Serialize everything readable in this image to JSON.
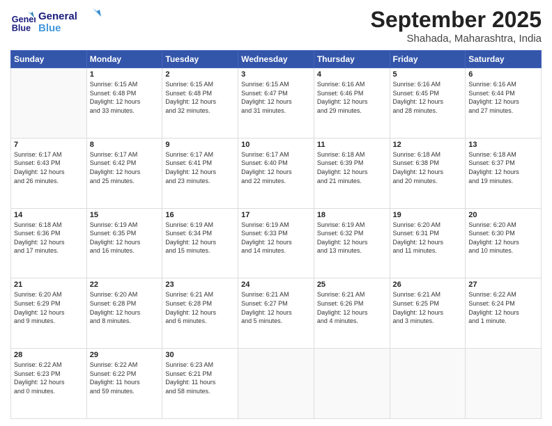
{
  "header": {
    "logo": {
      "line1": "General",
      "line2": "Blue"
    },
    "title": "September 2025",
    "subtitle": "Shahada, Maharashtra, India"
  },
  "weekdays": [
    "Sunday",
    "Monday",
    "Tuesday",
    "Wednesday",
    "Thursday",
    "Friday",
    "Saturday"
  ],
  "weeks": [
    [
      {
        "day": "",
        "info": ""
      },
      {
        "day": "1",
        "info": "Sunrise: 6:15 AM\nSunset: 6:48 PM\nDaylight: 12 hours\nand 33 minutes."
      },
      {
        "day": "2",
        "info": "Sunrise: 6:15 AM\nSunset: 6:48 PM\nDaylight: 12 hours\nand 32 minutes."
      },
      {
        "day": "3",
        "info": "Sunrise: 6:15 AM\nSunset: 6:47 PM\nDaylight: 12 hours\nand 31 minutes."
      },
      {
        "day": "4",
        "info": "Sunrise: 6:16 AM\nSunset: 6:46 PM\nDaylight: 12 hours\nand 29 minutes."
      },
      {
        "day": "5",
        "info": "Sunrise: 6:16 AM\nSunset: 6:45 PM\nDaylight: 12 hours\nand 28 minutes."
      },
      {
        "day": "6",
        "info": "Sunrise: 6:16 AM\nSunset: 6:44 PM\nDaylight: 12 hours\nand 27 minutes."
      }
    ],
    [
      {
        "day": "7",
        "info": "Sunrise: 6:17 AM\nSunset: 6:43 PM\nDaylight: 12 hours\nand 26 minutes."
      },
      {
        "day": "8",
        "info": "Sunrise: 6:17 AM\nSunset: 6:42 PM\nDaylight: 12 hours\nand 25 minutes."
      },
      {
        "day": "9",
        "info": "Sunrise: 6:17 AM\nSunset: 6:41 PM\nDaylight: 12 hours\nand 23 minutes."
      },
      {
        "day": "10",
        "info": "Sunrise: 6:17 AM\nSunset: 6:40 PM\nDaylight: 12 hours\nand 22 minutes."
      },
      {
        "day": "11",
        "info": "Sunrise: 6:18 AM\nSunset: 6:39 PM\nDaylight: 12 hours\nand 21 minutes."
      },
      {
        "day": "12",
        "info": "Sunrise: 6:18 AM\nSunset: 6:38 PM\nDaylight: 12 hours\nand 20 minutes."
      },
      {
        "day": "13",
        "info": "Sunrise: 6:18 AM\nSunset: 6:37 PM\nDaylight: 12 hours\nand 19 minutes."
      }
    ],
    [
      {
        "day": "14",
        "info": "Sunrise: 6:18 AM\nSunset: 6:36 PM\nDaylight: 12 hours\nand 17 minutes."
      },
      {
        "day": "15",
        "info": "Sunrise: 6:19 AM\nSunset: 6:35 PM\nDaylight: 12 hours\nand 16 minutes."
      },
      {
        "day": "16",
        "info": "Sunrise: 6:19 AM\nSunset: 6:34 PM\nDaylight: 12 hours\nand 15 minutes."
      },
      {
        "day": "17",
        "info": "Sunrise: 6:19 AM\nSunset: 6:33 PM\nDaylight: 12 hours\nand 14 minutes."
      },
      {
        "day": "18",
        "info": "Sunrise: 6:19 AM\nSunset: 6:32 PM\nDaylight: 12 hours\nand 13 minutes."
      },
      {
        "day": "19",
        "info": "Sunrise: 6:20 AM\nSunset: 6:31 PM\nDaylight: 12 hours\nand 11 minutes."
      },
      {
        "day": "20",
        "info": "Sunrise: 6:20 AM\nSunset: 6:30 PM\nDaylight: 12 hours\nand 10 minutes."
      }
    ],
    [
      {
        "day": "21",
        "info": "Sunrise: 6:20 AM\nSunset: 6:29 PM\nDaylight: 12 hours\nand 9 minutes."
      },
      {
        "day": "22",
        "info": "Sunrise: 6:20 AM\nSunset: 6:28 PM\nDaylight: 12 hours\nand 8 minutes."
      },
      {
        "day": "23",
        "info": "Sunrise: 6:21 AM\nSunset: 6:28 PM\nDaylight: 12 hours\nand 6 minutes."
      },
      {
        "day": "24",
        "info": "Sunrise: 6:21 AM\nSunset: 6:27 PM\nDaylight: 12 hours\nand 5 minutes."
      },
      {
        "day": "25",
        "info": "Sunrise: 6:21 AM\nSunset: 6:26 PM\nDaylight: 12 hours\nand 4 minutes."
      },
      {
        "day": "26",
        "info": "Sunrise: 6:21 AM\nSunset: 6:25 PM\nDaylight: 12 hours\nand 3 minutes."
      },
      {
        "day": "27",
        "info": "Sunrise: 6:22 AM\nSunset: 6:24 PM\nDaylight: 12 hours\nand 1 minute."
      }
    ],
    [
      {
        "day": "28",
        "info": "Sunrise: 6:22 AM\nSunset: 6:23 PM\nDaylight: 12 hours\nand 0 minutes."
      },
      {
        "day": "29",
        "info": "Sunrise: 6:22 AM\nSunset: 6:22 PM\nDaylight: 11 hours\nand 59 minutes."
      },
      {
        "day": "30",
        "info": "Sunrise: 6:23 AM\nSunset: 6:21 PM\nDaylight: 11 hours\nand 58 minutes."
      },
      {
        "day": "",
        "info": ""
      },
      {
        "day": "",
        "info": ""
      },
      {
        "day": "",
        "info": ""
      },
      {
        "day": "",
        "info": ""
      }
    ]
  ]
}
